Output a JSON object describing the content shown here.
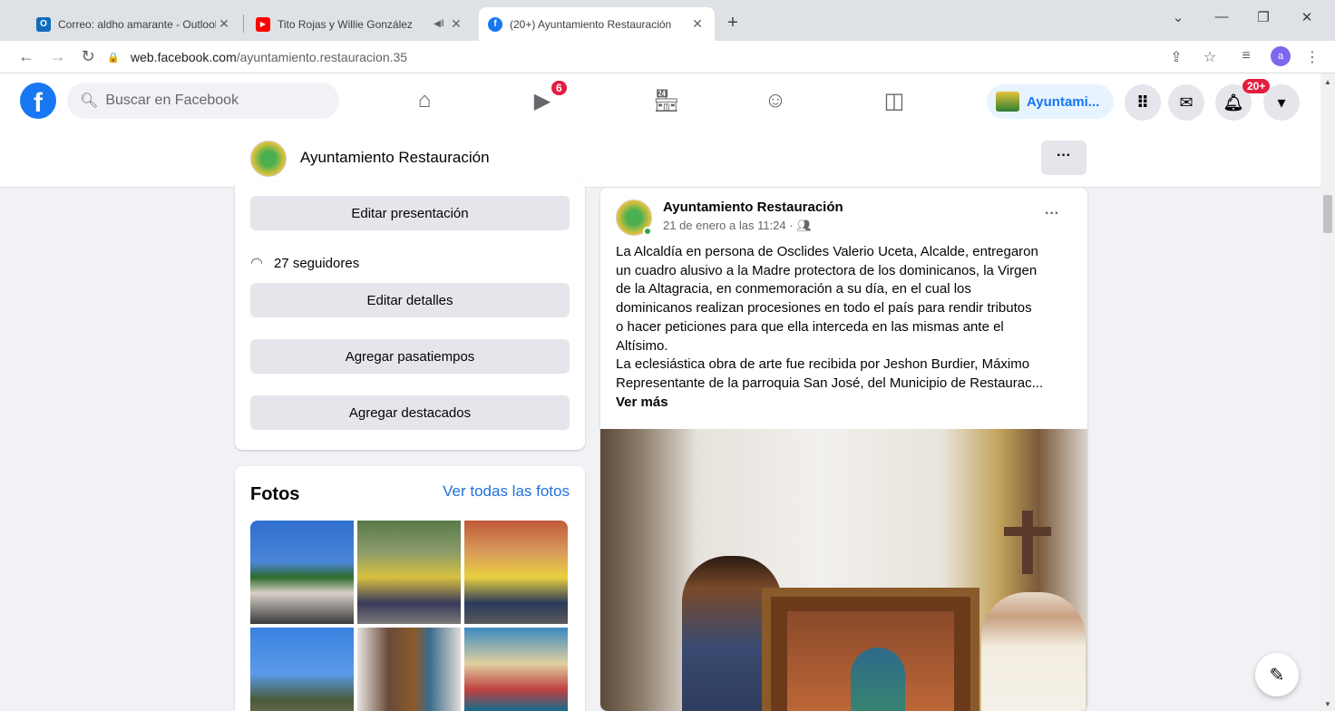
{
  "browser": {
    "tabs": [
      {
        "title": "Correo: aldho amarante - Outlook",
        "favicon": "outlook-icon",
        "color": "#0f6cbd"
      },
      {
        "title": "Tito Rojas y Willie González",
        "favicon": "youtube-icon",
        "color": "#ff0000"
      },
      {
        "title": "(20+) Ayuntamiento Restauración",
        "favicon": "facebook-icon",
        "color": "#1877f2"
      }
    ],
    "url_host": "web.facebook.com",
    "url_path": "/ayuntamiento.restauracion.35",
    "profile_letter": "a"
  },
  "fb": {
    "search_placeholder": "Buscar en Facebook",
    "watch_badge": "6",
    "notif_badge": "20+",
    "page_shortcut": "Ayuntami..."
  },
  "pagebar": {
    "name": "Ayuntamiento Restauración",
    "more": "···"
  },
  "intro": {
    "edit_presentation": "Editar presentación",
    "followers": "27 seguidores",
    "edit_details": "Editar detalles",
    "add_hobbies": "Agregar pasatiempos",
    "add_featured": "Agregar destacados"
  },
  "photos": {
    "title": "Fotos",
    "see_all": "Ver todas las fotos"
  },
  "post": {
    "author": "Ayuntamiento Restauración",
    "meta": "21 de enero a las 11:24 · ",
    "more": "···",
    "text_lines": [
      "La Alcaldía en persona de Osclides Valerio Uceta, Alcalde, entregaron",
      "un cuadro alusivo a la Madre protectora de los dominicanos, la Virgen",
      "de la Altagracia, en conmemoración a su día, en el cual los",
      "dominicanos realizan procesiones en todo el país para rendir tributos",
      "o hacer peticiones para que ella interceda en las mismas ante el",
      "Altísimo.",
      "La eclesiástica obra de arte fue recibida por Jeshon Burdier, Máximo",
      "Representante de la parroquia San José, del Municipio de Restaurac..."
    ],
    "see_more": "Ver más"
  },
  "colors": {
    "fb_blue": "#1877f2",
    "badge_red": "#e41e3f",
    "link_blue": "#216fdb"
  }
}
